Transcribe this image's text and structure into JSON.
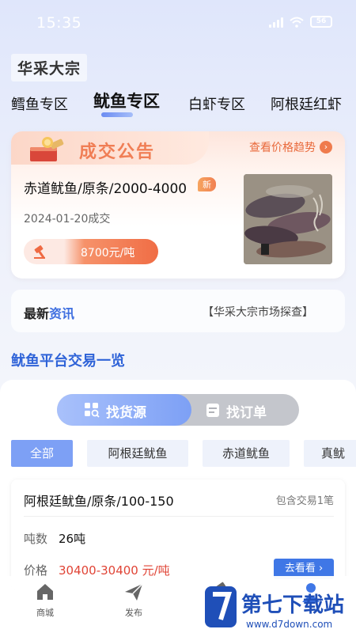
{
  "status_bar": {
    "time": "15:35",
    "battery": "56"
  },
  "brand": "华采大宗",
  "category_tabs": [
    "鳕鱼专区",
    "鱿鱼专区",
    "白虾专区",
    "阿根廷红虾"
  ],
  "deal_card": {
    "title": "成交公告",
    "trend_link": "查看价格趋势",
    "product": "赤道鱿鱼/原条/2000-4000",
    "badge": "新",
    "date": "2024-01-20成交",
    "price": "8700元/吨"
  },
  "news": {
    "label_prefix": "最新",
    "label_suffix": "资讯",
    "headline": "【华采大宗市场探查】"
  },
  "section_title": "鱿鱼平台交易一览",
  "switcher": {
    "left": "找货源",
    "right": "找订单"
  },
  "filters": [
    "全部",
    "阿根廷鱿鱼",
    "赤道鱿鱼",
    "真鱿"
  ],
  "listing": {
    "name": "阿根廷鱿鱼/原条/100-150",
    "deals": "包含交易1笔",
    "qty_label": "吨数",
    "qty": "26吨",
    "price_label": "价格",
    "price": "30400-30400 元/吨",
    "action": "去看看"
  },
  "tabbar": [
    {
      "label": "商城",
      "icon": "home-icon"
    },
    {
      "label": "发布",
      "icon": "send-icon"
    },
    {
      "label": "",
      "icon": "gavel-icon"
    },
    {
      "label": "",
      "icon": "user-icon"
    }
  ],
  "watermark": {
    "title": "第七下载站",
    "url": "www.d7down.com"
  },
  "colors": {
    "accent": "#3f77e6",
    "orange": "#f07e55",
    "price_red": "#e04436"
  }
}
